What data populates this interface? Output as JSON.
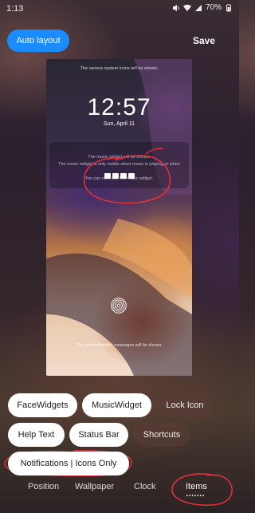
{
  "status_bar": {
    "time": "1:13",
    "battery": "70%"
  },
  "header": {
    "auto_layout_label": "Auto layout",
    "save_label": "Save"
  },
  "preview": {
    "top_text": "The various system icons will be shown.",
    "clock": "12:57",
    "date": "Sun, April 11",
    "music_lines": [
      "The music widget will be shown.",
      "The music widget is only visible when music is playing or when",
      "You can now see the music widget."
    ],
    "bottom_text": "The various helpful messages will be shown."
  },
  "chips": [
    {
      "label": "FaceWidgets",
      "state": "on"
    },
    {
      "label": "MusicWidget",
      "state": "on"
    },
    {
      "label": "Lock Icon",
      "state": "off"
    },
    {
      "label": "Help Text",
      "state": "on"
    },
    {
      "label": "Status Bar",
      "state": "on"
    },
    {
      "label": "Shortcuts",
      "state": "off"
    },
    {
      "label": "Notifications | Icons Only",
      "state": "on"
    }
  ],
  "tabs": [
    {
      "label": "Position"
    },
    {
      "label": "Wallpaper"
    },
    {
      "label": "Clock"
    },
    {
      "label": "Items",
      "active": true
    }
  ],
  "colors": {
    "accent": "#1a8cff",
    "annotation": "#e0303a"
  }
}
